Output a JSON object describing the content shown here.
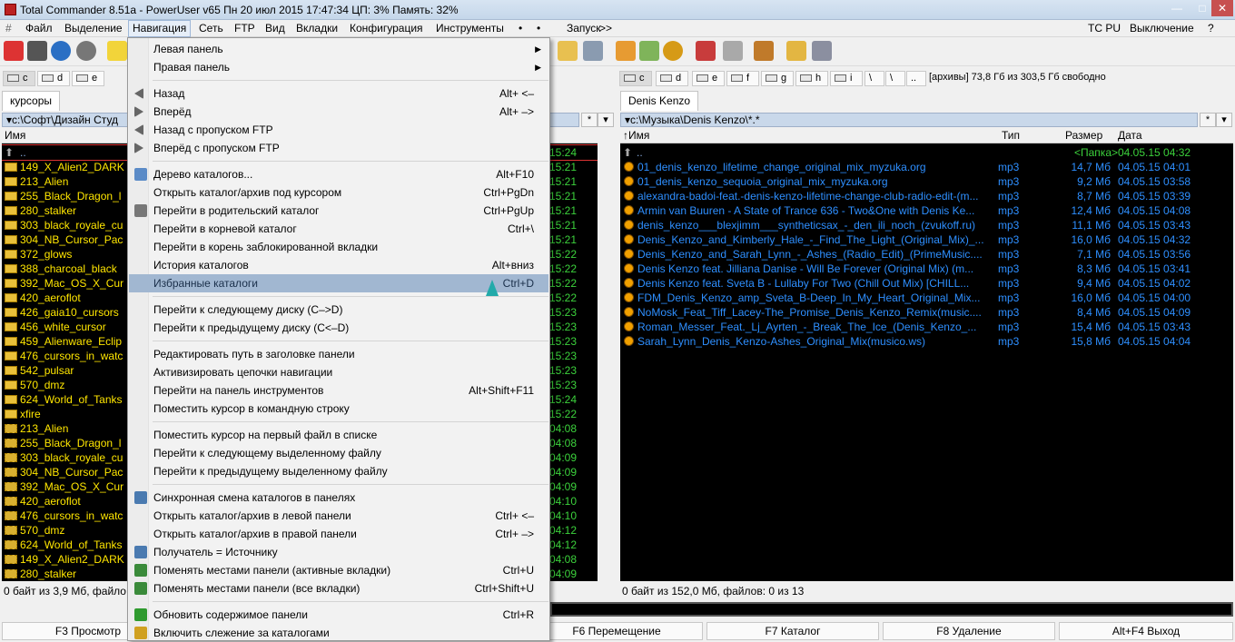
{
  "window": {
    "title": "Total Commander 8.51a - PowerUser v65     Пн 20 июл 2015     17:47:34   ЦП: 3%     Память: 32%"
  },
  "menubar": {
    "items": [
      "Файл",
      "Выделение",
      "Навигация",
      "Сеть",
      "FTP",
      "Вид",
      "Вкладки",
      "Конфигурация",
      "Инструменты",
      "•",
      "•",
      "Запуск",
      ">>"
    ],
    "right": [
      "TC PU",
      "Выключение",
      "?"
    ]
  },
  "drives_left": [
    "c",
    "d",
    "e"
  ],
  "drives_right": [
    "c",
    "d",
    "e",
    "f",
    "g",
    "h",
    "i",
    "\\",
    "\\",
    ".."
  ],
  "drive_info_right": "[архивы]  73,8 Гб из 303,5 Гб свободно",
  "tabs": {
    "left": "курсоры",
    "right": "Denis Kenzo"
  },
  "left_panel": {
    "path": "▾c:\\Софт\\Дизайн Студ",
    "header_name": "Имя",
    "rows": [
      {
        "name": "..",
        "time": "15:24",
        "type": "up"
      },
      {
        "name": "149_X_Alien2_DARK",
        "time": "15:21",
        "type": "folder"
      },
      {
        "name": "213_Alien",
        "time": "15:21",
        "type": "folder"
      },
      {
        "name": "255_Black_Dragon_l",
        "time": "15:21",
        "type": "folder"
      },
      {
        "name": "280_stalker",
        "time": "15:21",
        "type": "folder"
      },
      {
        "name": "303_black_royale_cu",
        "time": "15:21",
        "type": "folder"
      },
      {
        "name": "304_NB_Cursor_Pac",
        "time": "15:21",
        "type": "folder"
      },
      {
        "name": "372_glows",
        "time": "15:22",
        "type": "folder"
      },
      {
        "name": "388_charcoal_black",
        "time": "15:22",
        "type": "folder"
      },
      {
        "name": "392_Mac_OS_X_Cur",
        "time": "15:22",
        "type": "folder"
      },
      {
        "name": "420_aeroflot",
        "time": "15:22",
        "type": "folder"
      },
      {
        "name": "426_gaia10_cursors",
        "time": "15:23",
        "type": "folder"
      },
      {
        "name": "456_white_cursor",
        "time": "15:23",
        "type": "folder"
      },
      {
        "name": "459_Alienware_Eclip",
        "time": "15:23",
        "type": "folder"
      },
      {
        "name": "476_cursors_in_watc",
        "time": "15:23",
        "type": "folder"
      },
      {
        "name": "542_pulsar",
        "time": "15:23",
        "type": "folder"
      },
      {
        "name": "570_dmz",
        "time": "15:23",
        "type": "folder"
      },
      {
        "name": "624_World_of_Tanks",
        "time": "15:24",
        "type": "folder"
      },
      {
        "name": "xfire",
        "time": "15:22",
        "type": "folder"
      },
      {
        "name": "213_Alien",
        "time": "04:08",
        "type": "archive"
      },
      {
        "name": "255_Black_Dragon_l",
        "time": "04:08",
        "type": "archive"
      },
      {
        "name": "303_black_royale_cu",
        "time": "04:09",
        "type": "archive"
      },
      {
        "name": "304_NB_Cursor_Pac",
        "time": "04:09",
        "type": "archive"
      },
      {
        "name": "392_Mac_OS_X_Cur",
        "time": "04:09",
        "type": "archive"
      },
      {
        "name": "420_aeroflot",
        "time": "04:10",
        "type": "archive"
      },
      {
        "name": "476_cursors_in_watc",
        "time": "04:10",
        "type": "archive"
      },
      {
        "name": "570_dmz",
        "time": "04:12",
        "type": "archive"
      },
      {
        "name": "624_World_of_Tanks",
        "time": "04:12",
        "type": "archive"
      },
      {
        "name": "149_X_Alien2_DARK",
        "time": "04:08",
        "type": "archive"
      },
      {
        "name": "280_stalker",
        "time": "04:09",
        "type": "archive"
      }
    ],
    "status": "0 байт из 3,9 Мб, файло"
  },
  "right_panel": {
    "path": "▾c:\\Музыка\\Denis Kenzo\\*.*",
    "header": {
      "name": "↑Имя",
      "type": "Тип",
      "size": "Размер",
      "date": "Дата"
    },
    "up": {
      "name": "..",
      "size": "<Папка>",
      "date": "04.05.15 04:32"
    },
    "rows": [
      {
        "name": "01_denis_kenzo_lifetime_change_original_mix_myzuka.org",
        "type": "mp3",
        "size": "14,7 Мб",
        "date": "04.05.15 04:01"
      },
      {
        "name": "01_denis_kenzo_sequoia_original_mix_myzuka.org",
        "type": "mp3",
        "size": "9,2 Мб",
        "date": "04.05.15 03:58"
      },
      {
        "name": "alexandra-badoi-feat.-denis-kenzo-lifetime-change-club-radio-edit-(m...",
        "type": "mp3",
        "size": "8,7 Мб",
        "date": "04.05.15 03:39"
      },
      {
        "name": "Armin van Buuren - A State of Trance 636 - Two&One with Denis Ke...",
        "type": "mp3",
        "size": "12,4 Мб",
        "date": "04.05.15 04:08"
      },
      {
        "name": "denis_kenzo___blexjimm___syntheticsax_-_den_ili_noch_(zvukoff.ru)",
        "type": "mp3",
        "size": "11,1 Мб",
        "date": "04.05.15 03:43"
      },
      {
        "name": "Denis_Kenzo_and_Kimberly_Hale_-_Find_The_Light_(Original_Mix)_...",
        "type": "mp3",
        "size": "16,0 Мб",
        "date": "04.05.15 04:32"
      },
      {
        "name": "Denis_Kenzo_and_Sarah_Lynn_-_Ashes_(Radio_Edit)_(PrimeMusic....",
        "type": "mp3",
        "size": "7,1 Мб",
        "date": "04.05.15 03:56"
      },
      {
        "name": "Denis Kenzo feat. Jilliana Danise - Will Be Forever (Original Mix) (m...",
        "type": "mp3",
        "size": "8,3 Мб",
        "date": "04.05.15 03:41"
      },
      {
        "name": "Denis Kenzo feat. Sveta B - Lullaby For Two (Chill Out Mix) [CHILL...",
        "type": "mp3",
        "size": "9,4 Мб",
        "date": "04.05.15 04:02"
      },
      {
        "name": "FDM_Denis_Kenzo_amp_Sveta_B-Deep_In_My_Heart_Original_Mix...",
        "type": "mp3",
        "size": "16,0 Мб",
        "date": "04.05.15 04:00"
      },
      {
        "name": "NoMosk_Feat_Tiff_Lacey-The_Promise_Denis_Kenzo_Remix(music....",
        "type": "mp3",
        "size": "8,4 Мб",
        "date": "04.05.15 04:09"
      },
      {
        "name": "Roman_Messer_Feat._Lj_Ayrten_-_Break_The_Ice_(Denis_Kenzo_...",
        "type": "mp3",
        "size": "15,4 Мб",
        "date": "04.05.15 03:43"
      },
      {
        "name": "Sarah_Lynn_Denis_Kenzo-Ashes_Original_Mix(musico.ws)",
        "type": "mp3",
        "size": "15,8 Мб",
        "date": "04.05.15 04:04"
      }
    ],
    "status": "0 байт из 152,0 Мб, файлов: 0 из 13"
  },
  "fkeys": [
    "F3 Просмотр",
    "F6 Перемещение",
    "F7 Каталог",
    "F8 Удаление",
    "Alt+F4 Выход"
  ],
  "menu": [
    {
      "label": "Левая панель",
      "shortcut": "",
      "submenu": true
    },
    {
      "label": "Правая панель",
      "shortcut": "",
      "submenu": true
    },
    {
      "sep": true
    },
    {
      "label": "Назад",
      "shortcut": "Alt+ <–",
      "icon": "back-icon"
    },
    {
      "label": "Вперёд",
      "shortcut": "Alt+ –>",
      "icon": "forward-icon"
    },
    {
      "label": "Назад с пропуском FTP",
      "shortcut": "",
      "icon": "back-icon"
    },
    {
      "label": "Вперёд с пропуском FTP",
      "shortcut": "",
      "icon": "forward-icon"
    },
    {
      "sep": true
    },
    {
      "label": "Дерево каталогов...",
      "shortcut": "Alt+F10",
      "icon": "tree-icon"
    },
    {
      "label": "Открыть каталог/архив под курсором",
      "shortcut": "Ctrl+PgDn"
    },
    {
      "label": "Перейти в родительский каталог",
      "shortcut": "Ctrl+PgUp",
      "icon": "parent-dir-icon"
    },
    {
      "label": "Перейти в корневой каталог",
      "shortcut": "Ctrl+\\"
    },
    {
      "label": "Перейти в корень заблокированной вкладки",
      "shortcut": ""
    },
    {
      "label": "История каталогов",
      "shortcut": "Alt+вниз"
    },
    {
      "label": "Избранные каталоги",
      "shortcut": "Ctrl+D",
      "highlight": true
    },
    {
      "sep": true
    },
    {
      "label": "Перейти к следующему диску (C–>D)",
      "shortcut": ""
    },
    {
      "label": "Перейти к предыдущему диску (C<–D)",
      "shortcut": ""
    },
    {
      "sep": true
    },
    {
      "label": "Редактировать путь в заголовке панели",
      "shortcut": ""
    },
    {
      "label": "Активизировать цепочки навигации",
      "shortcut": ""
    },
    {
      "label": "Перейти на панель инструментов",
      "shortcut": "Alt+Shift+F11"
    },
    {
      "label": "Поместить курсор в командную строку",
      "shortcut": ""
    },
    {
      "sep": true
    },
    {
      "label": "Поместить курсор на первый файл в списке",
      "shortcut": ""
    },
    {
      "label": "Перейти к следующему выделенному файлу",
      "shortcut": ""
    },
    {
      "label": "Перейти к предыдущему выделенному файлу",
      "shortcut": ""
    },
    {
      "sep": true
    },
    {
      "label": "Синхронная смена каталогов в панелях",
      "shortcut": "",
      "icon": "sync-icon"
    },
    {
      "label": "Открыть каталог/архив в левой панели",
      "shortcut": "Ctrl+ <–"
    },
    {
      "label": "Открыть каталог/архив в правой панели",
      "shortcut": "Ctrl+ –>"
    },
    {
      "label": "Получатель = Источнику",
      "shortcut": "",
      "icon": "equal-icon"
    },
    {
      "label": "Поменять местами панели (активные вкладки)",
      "shortcut": "Ctrl+U",
      "icon": "swap-icon"
    },
    {
      "label": "Поменять местами панели (все вкладки)",
      "shortcut": "Ctrl+Shift+U",
      "icon": "swap-icon"
    },
    {
      "sep": true
    },
    {
      "label": "Обновить содержимое панели",
      "shortcut": "Ctrl+R",
      "icon": "refresh-icon"
    },
    {
      "label": "Включить слежение за каталогами",
      "shortcut": "",
      "icon": "watch-icon"
    }
  ]
}
